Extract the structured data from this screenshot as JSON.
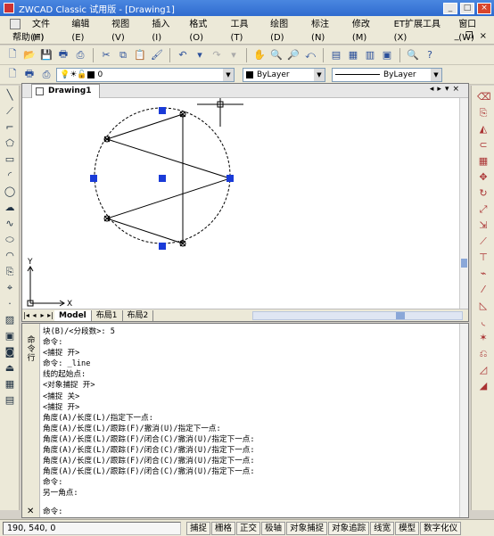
{
  "window": {
    "title": "ZWCAD Classic 试用版 - [Drawing1]"
  },
  "menu": {
    "items": [
      "文件(F)",
      "编辑(E)",
      "视图(V)",
      "插入(I)",
      "格式(O)",
      "工具(T)",
      "绘图(D)",
      "标注(N)",
      "修改(M)",
      "ET扩展工具(X)",
      "窗口(W)"
    ],
    "help": "帮助(H)"
  },
  "properties_toolbar": {
    "layer_value": "0",
    "color_value": "ByLayer",
    "linetype_value": "ByLayer"
  },
  "document": {
    "tab_label": "Drawing1",
    "layout_tabs": [
      "Model",
      "布局1",
      "布局2"
    ]
  },
  "ucs": {
    "x_label": "X",
    "y_label": "Y"
  },
  "command_panel": {
    "side_label": "命令行",
    "lines": [
      "块(B)/<分段数>: 5",
      "命令:",
      "<捕捉 开>",
      "命令: _line",
      "线的起始点:",
      "<对象捕捉 开>",
      "<捕捉 关>",
      "<捕捉 开>",
      "角度(A)/长度(L)/指定下一点:",
      "角度(A)/长度(L)/跟踪(F)/撤消(U)/指定下一点:",
      "角度(A)/长度(L)/跟踪(F)/闭合(C)/撤消(U)/指定下一点:",
      "角度(A)/长度(L)/跟踪(F)/闭合(C)/撤消(U)/指定下一点:",
      "角度(A)/长度(L)/跟踪(F)/闭合(C)/撤消(U)/指定下一点:",
      "角度(A)/长度(L)/跟踪(F)/闭合(C)/撤消(U)/指定下一点:",
      "命令:",
      "另一角点:"
    ],
    "prompt": "命令:"
  },
  "statusbar": {
    "coords": "190, 540, 0",
    "buttons": [
      "捕捉",
      "栅格",
      "正交",
      "极轴",
      "对象捕捉",
      "对象追踪",
      "线宽",
      "模型",
      "数字化仪"
    ]
  },
  "colors": {
    "title_bar": "#3a78d8",
    "grip": "#1a3bd8"
  }
}
